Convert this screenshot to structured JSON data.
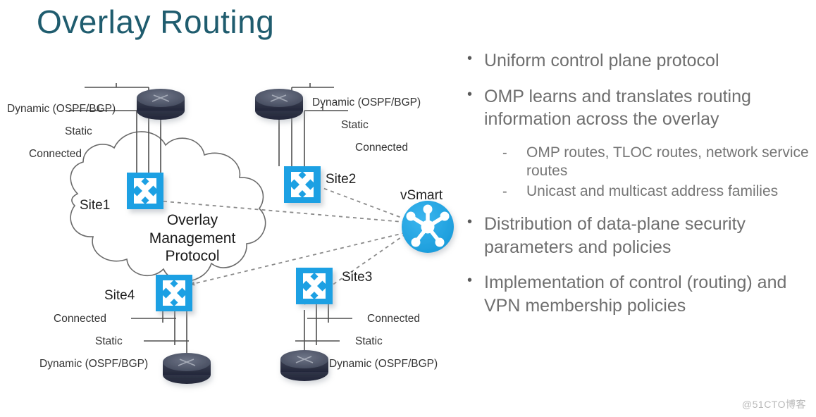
{
  "slide": {
    "title": "Overlay Routing",
    "watermark": "@51CTO博客"
  },
  "colors": {
    "title": "#1f5c6e",
    "site_blue": "#1ca0e3",
    "vsmart_blue": "#1ca0e3",
    "router_dark": "#3a3f4e",
    "body_text": "#6f6f6f",
    "label_text": "#333333",
    "cloud_line": "#6b6b6b",
    "dashed_line": "#8a8a8a"
  },
  "diagram": {
    "cloud_text_lines": [
      "Overlay",
      "Management",
      "Protocol"
    ],
    "vsmart": {
      "label": "vSmart",
      "icon": "network-hub-icon"
    },
    "sites": [
      {
        "id": "site1",
        "label": "Site1",
        "icon": "sdwan-edge-router-icon",
        "router_icon": "router-icon",
        "route_labels": [
          "Dynamic (OSPF/BGP)",
          "Static",
          "Connected"
        ]
      },
      {
        "id": "site2",
        "label": "Site2",
        "icon": "sdwan-edge-router-icon",
        "router_icon": "router-icon",
        "route_labels": [
          "Dynamic (OSPF/BGP)",
          "Static",
          "Connected"
        ]
      },
      {
        "id": "site3",
        "label": "Site3",
        "icon": "sdwan-edge-router-icon",
        "router_icon": "router-icon",
        "route_labels": [
          "Connected",
          "Static",
          "Dynamic (OSPF/BGP)"
        ]
      },
      {
        "id": "site4",
        "label": "Site4",
        "icon": "sdwan-edge-router-icon",
        "router_icon": "router-icon",
        "route_labels": [
          "Connected",
          "Static",
          "Dynamic (OSPF/BGP)"
        ]
      }
    ]
  },
  "bullets": [
    {
      "marker": "•",
      "text": "Uniform control plane protocol",
      "sub": []
    },
    {
      "marker": "•",
      "text": "OMP learns and translates routing information across the overlay",
      "sub": [
        {
          "marker": "-",
          "text": "OMP routes, TLOC routes, network service routes"
        },
        {
          "marker": "-",
          "text": "Unicast and multicast address families"
        }
      ]
    },
    {
      "marker": "•",
      "text": "Distribution of data-plane security parameters and policies",
      "sub": []
    },
    {
      "marker": "•",
      "text": "Implementation of control (routing) and VPN membership policies",
      "sub": []
    }
  ]
}
